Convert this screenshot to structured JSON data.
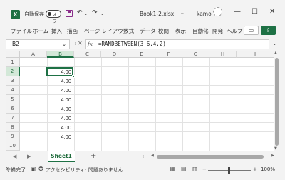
{
  "titlebar": {
    "app_icon": "excel-logo-icon",
    "app_icon_letter": "X",
    "autosave_label": "自動保存",
    "autosave_state": "オフ",
    "doc_title": "Book1-2.xlsx",
    "user_name": "kamo",
    "minimize": "—",
    "maximize": "☐",
    "close": "✕",
    "undo_glyph": "↶",
    "redo_glyph": "↷",
    "qa_more": "⌄",
    "doc_dropdown": "⌄"
  },
  "ribbon": {
    "tabs": [
      "ファイル",
      "ホーム",
      "挿入",
      "描画",
      "ページ レイアウト",
      "数式",
      "データ",
      "校閲",
      "表示",
      "自動化",
      "開発",
      "ヘルプ"
    ],
    "comment_glyph": "▭",
    "share_glyph": "⇪"
  },
  "formula_bar": {
    "name_box": "B2",
    "more_glyph": "⋮",
    "cancel_glyph": "✕",
    "enter_glyph": "✓",
    "fx_label": "fx",
    "formula": "=RANDBETWEEN(3.6,4.2)",
    "expand_glyph": "⌄"
  },
  "grid": {
    "columns": [
      "A",
      "B",
      "C",
      "D",
      "E",
      "F",
      "G",
      "H",
      "I"
    ],
    "selected_column": "B",
    "rows": [
      "1",
      "2",
      "3",
      "4",
      "5",
      "6",
      "7",
      "8",
      "9",
      "10"
    ],
    "selected_row": "2",
    "cells_B": [
      "",
      "4.00",
      "4.00",
      "4.00",
      "4.00",
      "4.00",
      "4.00",
      "4.00",
      "4.00",
      ""
    ]
  },
  "sheets": {
    "tabs": [
      "Sheet1"
    ],
    "active": "Sheet1",
    "add": "+",
    "nav_prev": "◀",
    "nav_next": "▶",
    "more": "⋮"
  },
  "status": {
    "ready": "準備完了",
    "accessibility": "アクセシビリティ: 問題ありません",
    "zoom": "100%",
    "zoom_minus": "−",
    "zoom_plus": "+"
  },
  "colors": {
    "accent": "#1e7145",
    "selected_header_bg": "#d3e8d8"
  }
}
